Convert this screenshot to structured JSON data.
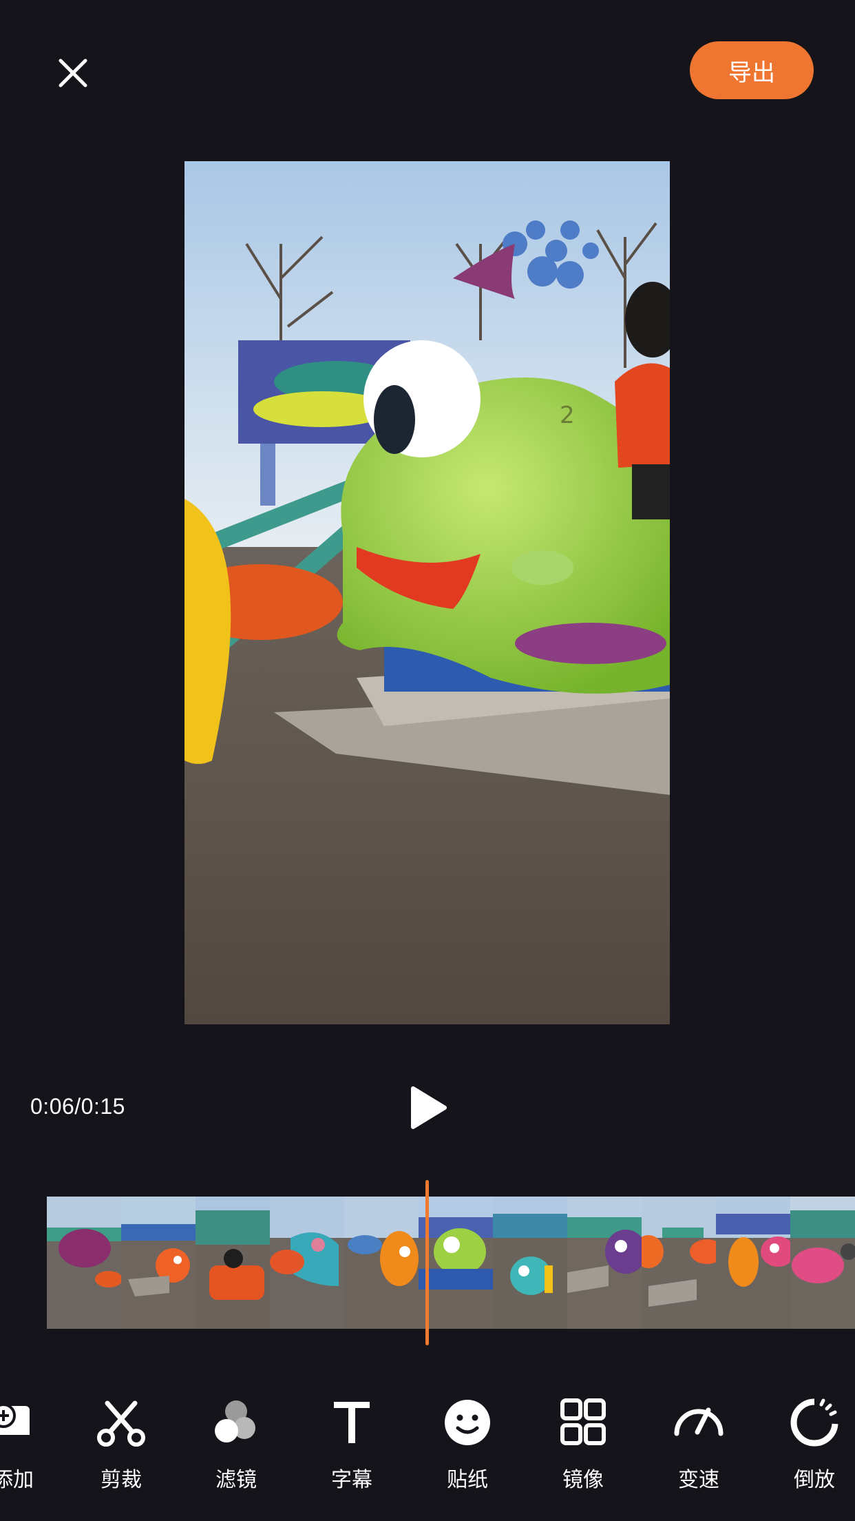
{
  "header": {
    "export_label": "导出"
  },
  "player": {
    "time": "0:06/0:15"
  },
  "toolbar": {
    "items": [
      {
        "label": "添加",
        "icon": "add-clip-icon"
      },
      {
        "label": "剪裁",
        "icon": "scissors-icon"
      },
      {
        "label": "滤镜",
        "icon": "filter-icon"
      },
      {
        "label": "字幕",
        "icon": "text-icon"
      },
      {
        "label": "贴纸",
        "icon": "sticker-icon"
      },
      {
        "label": "镜像",
        "icon": "mirror-icon"
      },
      {
        "label": "变速",
        "icon": "speed-icon"
      },
      {
        "label": "倒放",
        "icon": "reverse-icon"
      }
    ]
  },
  "colors": {
    "background": "#15141a",
    "accent": "#ee7630"
  }
}
